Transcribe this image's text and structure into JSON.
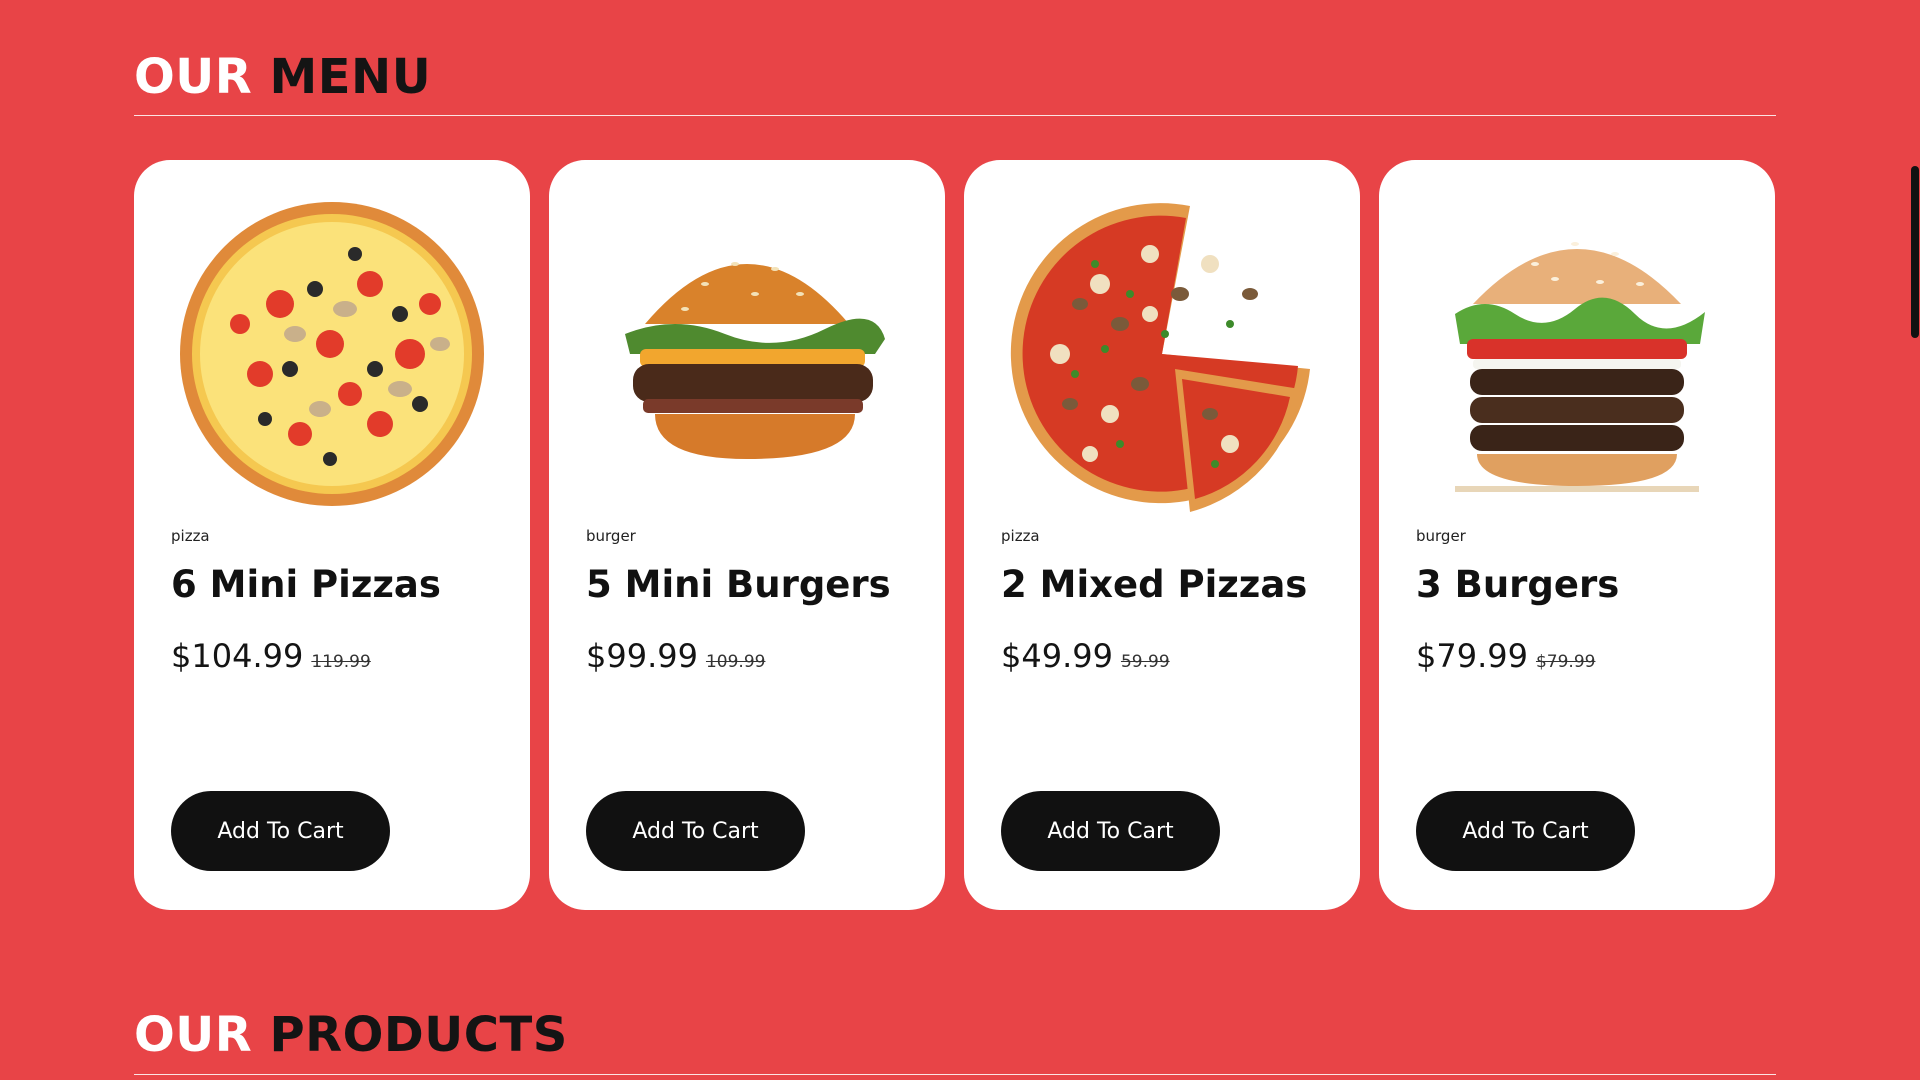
{
  "menu_section": {
    "title_word1": "OUR",
    "title_word2": "MENU"
  },
  "products_section": {
    "title_word1": "OUR",
    "title_word2": "PRODUCTS"
  },
  "cards": [
    {
      "category": "pizza",
      "name": "6 Mini Pizzas",
      "price": "$104.99",
      "old_price": "119.99",
      "button": "Add To Cart",
      "image": "mini-pizzas-image"
    },
    {
      "category": "burger",
      "name": "5 Mini Burgers",
      "price": "$99.99",
      "old_price": "109.99",
      "button": "Add To Cart",
      "image": "mini-burgers-image"
    },
    {
      "category": "pizza",
      "name": "2 Mixed Pizzas",
      "price": "$49.99",
      "old_price": "59.99",
      "button": "Add To Cart",
      "image": "mixed-pizzas-image"
    },
    {
      "category": "burger",
      "name": "3 Burgers",
      "price": "$79.99",
      "old_price": "$79.99",
      "button": "Add To Cart",
      "image": "burgers-image"
    }
  ],
  "colors": {
    "background": "#e84447",
    "card": "#ffffff",
    "button": "#111111",
    "title_accent": "#ffffff",
    "title_dark": "#141414"
  }
}
